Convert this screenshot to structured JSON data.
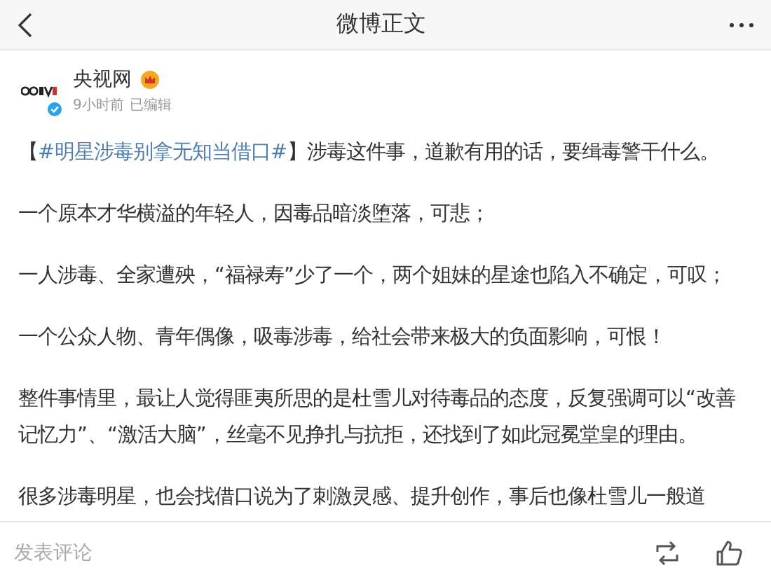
{
  "header": {
    "title": "微博正文"
  },
  "author": {
    "name": "央视网",
    "verified": true,
    "time": "9小时前",
    "edited": "已编辑"
  },
  "paragraphs": [
    {
      "parts": [
        {
          "kind": "plain",
          "text": "【"
        },
        {
          "kind": "hashtag",
          "text": "#明星涉毒别拿无知当借口#"
        },
        {
          "kind": "plain",
          "text": "】涉毒这件事，道歉有用的话，要缉毒警干什么。"
        }
      ]
    },
    {
      "parts": [
        {
          "kind": "plain",
          "text": "一个原本才华横溢的年轻人，因毒品暗淡堕落，可悲；"
        }
      ]
    },
    {
      "parts": [
        {
          "kind": "plain",
          "text": "一人涉毒、全家遭殃，“福禄寿”少了一个，两个姐妹的星途也陷入不确定，可叹；"
        }
      ]
    },
    {
      "parts": [
        {
          "kind": "plain",
          "text": "一个公众人物、青年偶像，吸毒涉毒，给社会带来极大的负面影响，可恨！"
        }
      ]
    },
    {
      "parts": [
        {
          "kind": "plain",
          "text": "整件事情里，最让人觉得匪夷所思的是杜雪儿对待毒品的态度，反复强调可以“改善记忆力”、“激活大脑”，丝毫不见挣扎与抗拒，还找到了如此冠冕堂皇的理由。"
        }
      ]
    },
    {
      "parts": [
        {
          "kind": "plain",
          "text": "很多涉毒明星，也会找借口说为了刺激灵感、提升创作，事后也像杜雪儿一般道"
        }
      ]
    }
  ],
  "bottom_bar": {
    "comment_placeholder": "发表评论"
  }
}
